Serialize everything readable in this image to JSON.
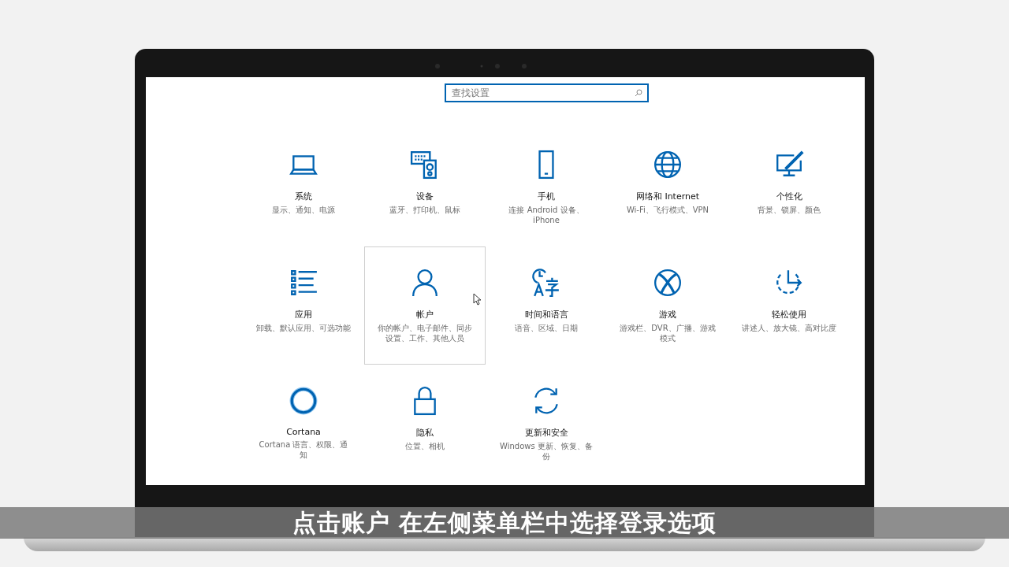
{
  "search": {
    "placeholder": "查找设置"
  },
  "tiles": [
    {
      "title": "系统",
      "subtitle": "显示、通知、电源",
      "selected": false
    },
    {
      "title": "设备",
      "subtitle": "蓝牙、打印机、鼠标",
      "selected": false
    },
    {
      "title": "手机",
      "subtitle": "连接 Android 设备、iPhone",
      "selected": false
    },
    {
      "title": "网络和 Internet",
      "subtitle": "Wi-Fi、飞行模式、VPN",
      "selected": false
    },
    {
      "title": "个性化",
      "subtitle": "背景、锁屏、颜色",
      "selected": false
    },
    {
      "title": "应用",
      "subtitle": "卸载、默认应用、可选功能",
      "selected": false
    },
    {
      "title": "帐户",
      "subtitle": "你的帐户、电子邮件、同步设置、工作、其他人员",
      "selected": true
    },
    {
      "title": "时间和语言",
      "subtitle": "语音、区域、日期",
      "selected": false
    },
    {
      "title": "游戏",
      "subtitle": "游戏栏、DVR、广播、游戏模式",
      "selected": false
    },
    {
      "title": "轻松使用",
      "subtitle": "讲述人、放大镜、高对比度",
      "selected": false
    },
    {
      "title": "Cortana",
      "subtitle": "Cortana 语言、权限、通知",
      "selected": false
    },
    {
      "title": "隐私",
      "subtitle": "位置、相机",
      "selected": false
    },
    {
      "title": "更新和安全",
      "subtitle": "Windows 更新、恢复、备份",
      "selected": false
    }
  ],
  "caption": "点击账户 在左侧菜单栏中选择登录选项"
}
